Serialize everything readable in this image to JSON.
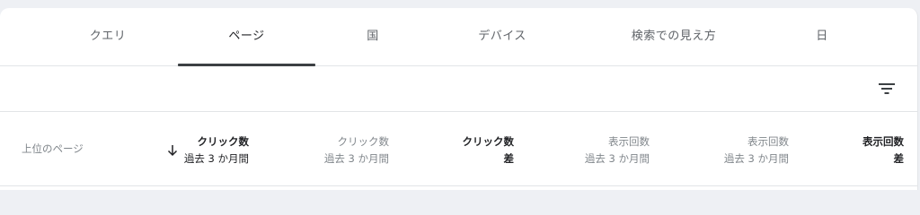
{
  "tabs": [
    {
      "label": "クエリ",
      "active": false
    },
    {
      "label": "ページ",
      "active": true
    },
    {
      "label": "国",
      "active": false
    },
    {
      "label": "デバイス",
      "active": false
    },
    {
      "label": "検索での見え方",
      "active": false
    },
    {
      "label": "日",
      "active": false
    }
  ],
  "toolbar": {
    "filter_icon": "filter-list-icon"
  },
  "table": {
    "row_label": "上位のページ",
    "sort_icon": "arrow-down-icon",
    "columns": [
      {
        "line1": "クリック数",
        "line2": "過去 3 か月間",
        "style": "sorted"
      },
      {
        "line1": "クリック数",
        "line2": "過去 3 か月間",
        "style": "normal"
      },
      {
        "line1": "クリック数",
        "line2": "差",
        "style": "bold"
      },
      {
        "line1": "表示回数",
        "line2": "過去 3 か月間",
        "style": "normal"
      },
      {
        "line1": "表示回数",
        "line2": "過去 3 か月間",
        "style": "normal"
      },
      {
        "line1": "表示回数",
        "line2": "差",
        "style": "bold"
      }
    ]
  },
  "colors": {
    "tab_indicator": "#3c4043",
    "text_primary": "#202124",
    "text_secondary": "#80868b"
  }
}
